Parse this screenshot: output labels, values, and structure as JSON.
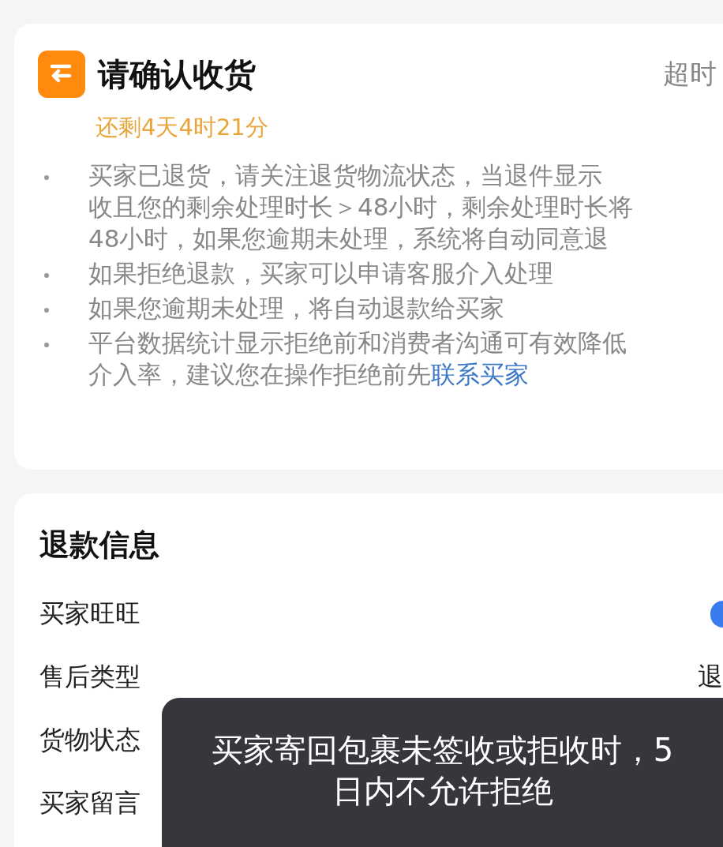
{
  "confirm_card": {
    "title": "请确认收货",
    "timeout_label": "超时",
    "countdown": "还剩4天4时21分",
    "bullets": [
      {
        "lines": [
          "买家已退货，请关注退货物流状态，当退件显示",
          "收且您的剩余处理时长＞48小时，剩余处理时长将",
          "48小时，如果您逾期未处理，系统将自动同意退"
        ]
      },
      {
        "lines": [
          "如果拒绝退款，买家可以申请客服介入处理"
        ]
      },
      {
        "lines": [
          "如果您逾期未处理，将自动退款给买家"
        ]
      },
      {
        "lines": [
          "平台数据统计显示拒绝前和消费者沟通可有效降低",
          "介入率，建议您在操作拒绝前先"
        ],
        "link": "联系买家"
      }
    ]
  },
  "refund_card": {
    "title": "退款信息",
    "rows": [
      {
        "label": "买家旺旺",
        "kind": "icon"
      },
      {
        "label": "售后类型",
        "kind": "text",
        "value": "退"
      },
      {
        "label": "货物状态",
        "kind": "empty"
      },
      {
        "label": "买家留言",
        "kind": "empty"
      }
    ]
  },
  "caption": {
    "lines": [
      "买家寄回包裹未签收或拒收时，5",
      "日内不允许拒绝"
    ]
  }
}
